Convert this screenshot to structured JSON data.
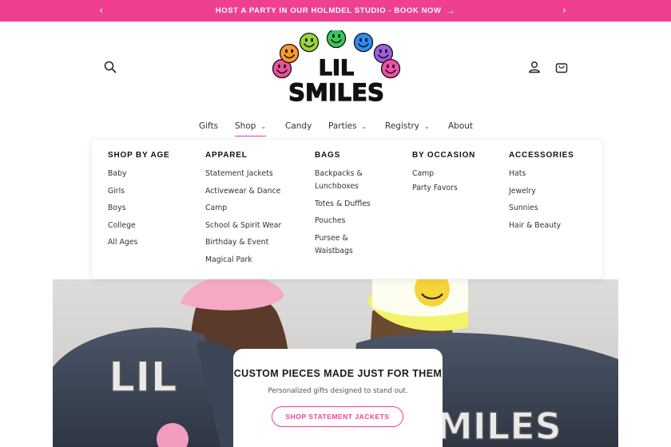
{
  "announcement": {
    "text": "HOST A PARTY IN OUR HOLMDEL STUDIO - BOOK NOW",
    "arrow": "→",
    "prev": "‹",
    "next": "›",
    "bg_color": "#ef3f91"
  },
  "header": {
    "icons": [
      "search-icon",
      "account-icon",
      "cart-icon"
    ],
    "logo": {
      "line1": "LIL",
      "line2": "SMILES",
      "smiley_colors": [
        "#f04f9c",
        "#f79a2a",
        "#9ad53a",
        "#38c85a",
        "#2f8cf0",
        "#a05ee0",
        "#ee4fa8"
      ]
    }
  },
  "nav": {
    "items": [
      {
        "label": "Gifts",
        "has_dropdown": false
      },
      {
        "label": "Shop",
        "has_dropdown": true,
        "active": true
      },
      {
        "label": "Candy",
        "has_dropdown": false
      },
      {
        "label": "Parties",
        "has_dropdown": true
      },
      {
        "label": "Registry",
        "has_dropdown": true
      },
      {
        "label": "About",
        "has_dropdown": false
      }
    ],
    "caret": "⌄"
  },
  "mega_menu": {
    "columns": [
      {
        "title": "SHOP BY AGE",
        "links": [
          "Baby",
          "Girls",
          "Boys",
          "College",
          "All Ages"
        ]
      },
      {
        "title": "APPAREL",
        "links": [
          "Statement Jackets",
          "Activewear & Dance",
          "Camp",
          "School & Spirit Wear",
          "Birthday & Event",
          "Magical Park"
        ]
      },
      {
        "title": "BAGS",
        "links": [
          "Backpacks &",
          "Lunchboxes",
          "Totes & Duffles",
          "Pouches",
          "Pursee &",
          "Waistbags"
        ]
      },
      {
        "title": "BY OCCASION",
        "links": [
          "Camp",
          "Party Favors"
        ]
      },
      {
        "title": "ACCESSORIES",
        "links": [
          "Hats",
          "Jewelry",
          "Sunnies",
          "Hair & Beauty"
        ]
      }
    ]
  },
  "hero": {
    "title": "CUSTOM PIECES MADE JUST FOR THEM",
    "subtitle": "Personalized gifts designed to stand out.",
    "button_label": "SHOP STATEMENT JACKETS",
    "jacket_text_left": "LIL",
    "jacket_text_right": "MILES",
    "accent_color": "#ef3f91"
  }
}
